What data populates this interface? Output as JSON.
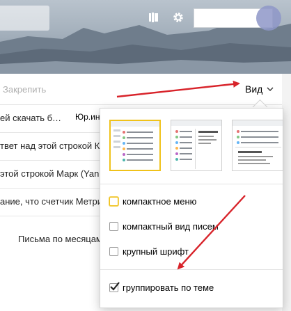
{
  "header": {
    "icons": [
      "theme-icon",
      "gear-icon"
    ],
    "user_name": ""
  },
  "toolbar": {
    "pin_label": "Закрепить",
    "view_label": "Вид"
  },
  "messages": [
    {
      "text": "ей скачать б…",
      "badge": "Юр.инф"
    },
    {
      "text": "твет над этой строкой Ко"
    },
    {
      "text": "этой строкой Марк (Yan"
    },
    {
      "text": "ание, что счетчик Метрик"
    }
  ],
  "months_label": "Письма по месяцам",
  "view_menu": {
    "layouts": [
      "layout-compact-list",
      "layout-two-pane",
      "layout-three-pane"
    ],
    "selected_layout": 0,
    "options": [
      {
        "label": "компактное меню",
        "checked": false,
        "highlighted": true
      },
      {
        "label": "компактный вид писем",
        "checked": false,
        "highlighted": false
      },
      {
        "label": "крупный шрифт",
        "checked": false,
        "highlighted": false
      },
      {
        "label": "группировать по теме",
        "checked": true,
        "highlighted": false
      }
    ]
  },
  "colors": {
    "accent": "#f0c21a",
    "arrow": "#d8232a"
  }
}
